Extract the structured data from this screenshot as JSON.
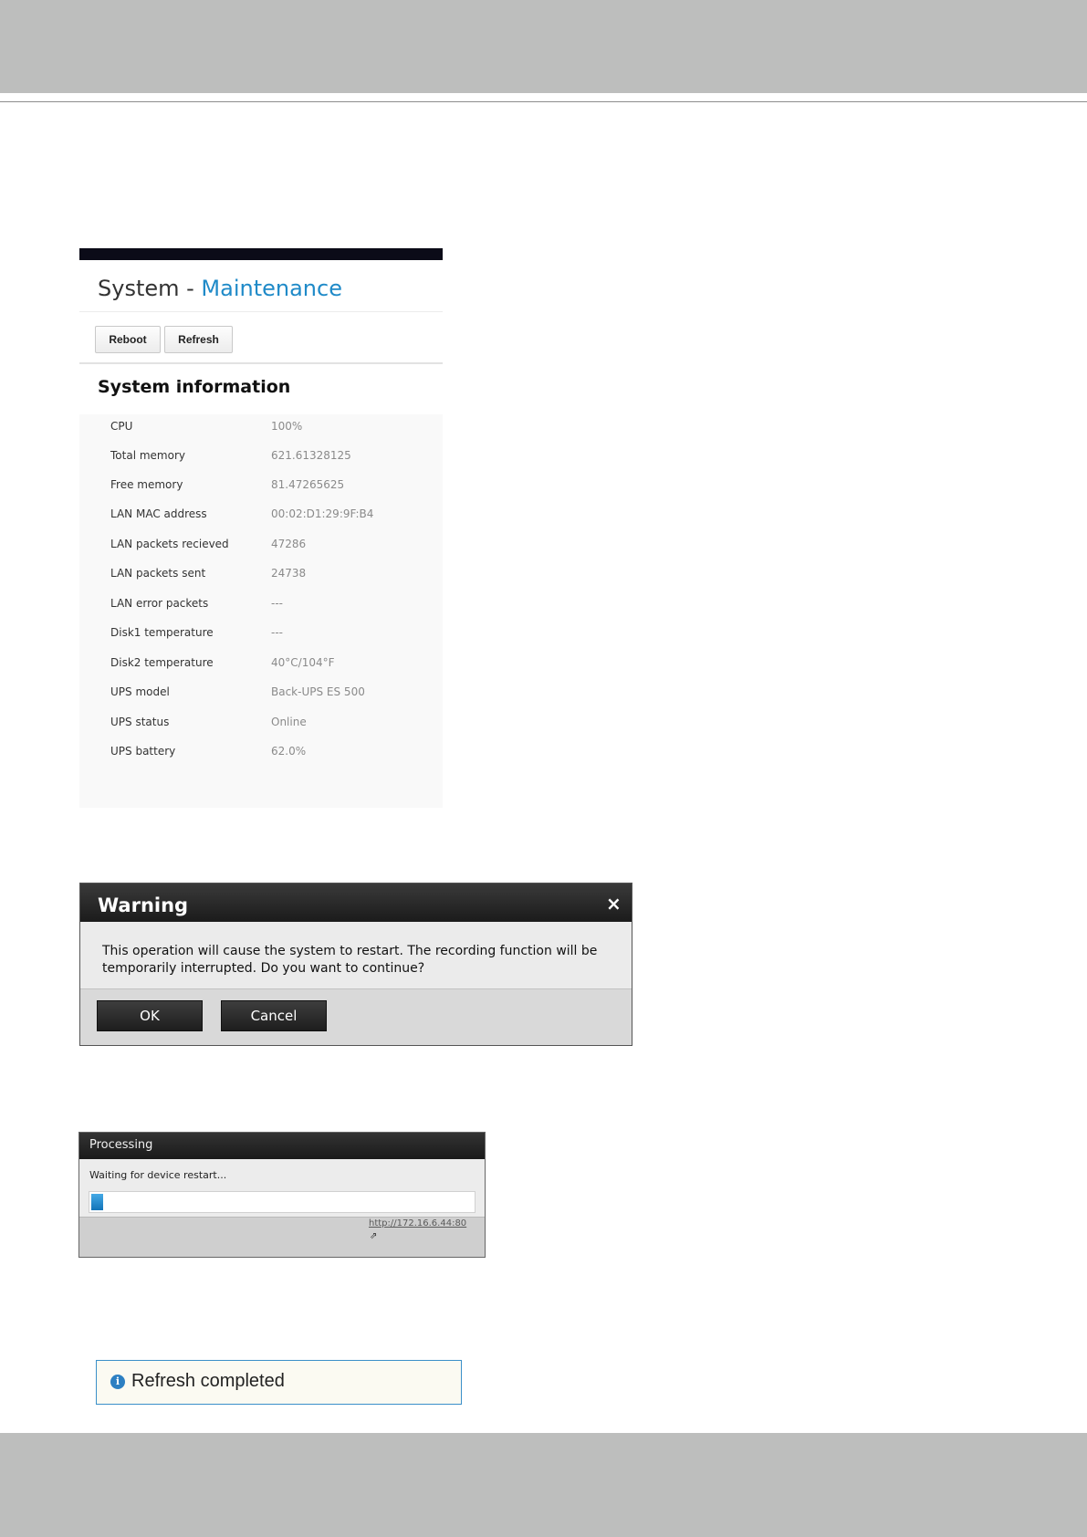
{
  "maintenance_panel": {
    "title_prefix": "System - ",
    "title_accent": "Maintenance",
    "buttons": {
      "reboot": "Reboot",
      "refresh": "Refresh"
    },
    "section_title": "System information",
    "rows": [
      {
        "label": "CPU",
        "value": "100%"
      },
      {
        "label": "Total memory",
        "value": "621.61328125"
      },
      {
        "label": "Free memory",
        "value": "81.47265625"
      },
      {
        "label": "LAN MAC address",
        "value": "00:02:D1:29:9F:B4"
      },
      {
        "label": "LAN packets recieved",
        "value": "47286"
      },
      {
        "label": "LAN packets sent",
        "value": "24738"
      },
      {
        "label": "LAN error packets",
        "value": "---"
      },
      {
        "label": "Disk1 temperature",
        "value": "---"
      },
      {
        "label": "Disk2 temperature",
        "value": "40°C/104°F"
      },
      {
        "label": "UPS model",
        "value": "Back-UPS ES 500"
      },
      {
        "label": "UPS status",
        "value": "Online"
      },
      {
        "label": "UPS battery",
        "value": "62.0%"
      }
    ]
  },
  "warning_dialog": {
    "title": "Warning",
    "close_glyph": "×",
    "message": "This operation will cause the system to restart. The recording function will be temporarily interrupted. Do you want to continue?",
    "ok_label": "OK",
    "cancel_label": "Cancel"
  },
  "processing_dialog": {
    "title": "Processing",
    "message": "Waiting for device restart...",
    "progress_fraction": 0.03,
    "link": "http://172.16.6.44:80",
    "link_icon": "external-link-icon",
    "link_glyph": "⇗"
  },
  "notice": {
    "icon": "info-icon",
    "icon_glyph": "i",
    "text": "Refresh completed"
  },
  "colors": {
    "accent": "#1f8ac8",
    "band_gray": "#bdbebd",
    "progress_blue": "#1273b8",
    "notice_border": "#3b8fc9"
  }
}
